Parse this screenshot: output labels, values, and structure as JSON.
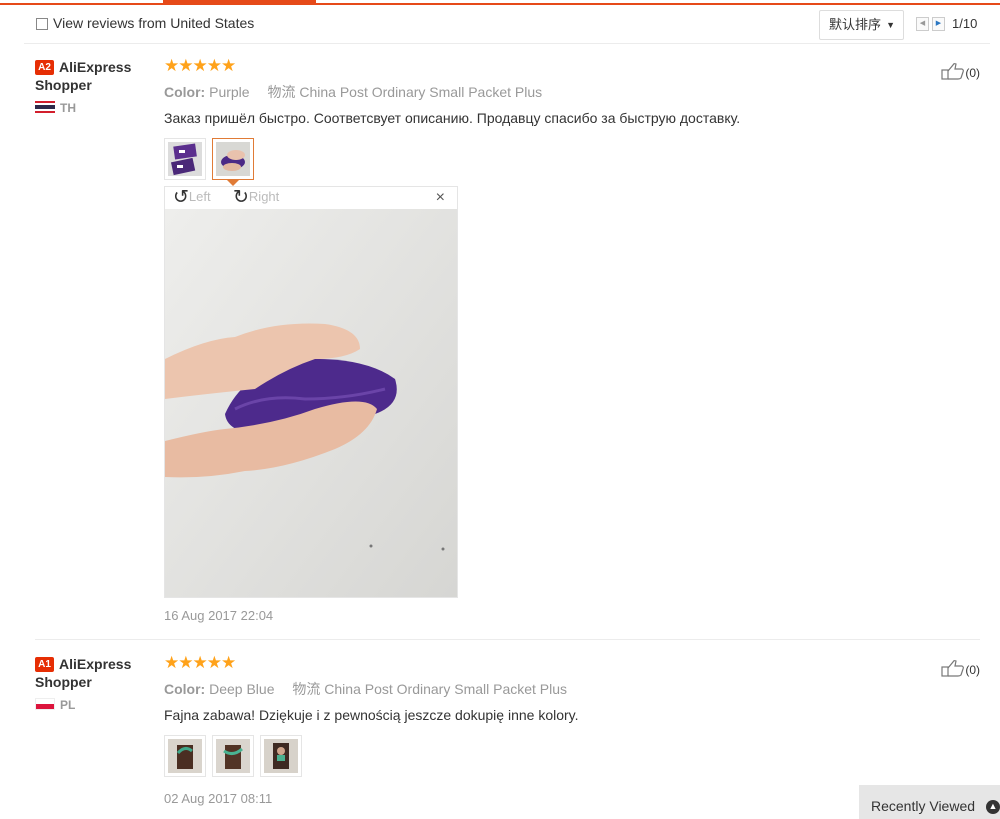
{
  "filter": {
    "checkbox_label": "View reviews from United States",
    "sort_label": "默认排序",
    "page_indicator": "1/10"
  },
  "reviews": [
    {
      "level": "A2",
      "user_first": "AliExpress",
      "user_second": "Shopper",
      "country": "TH",
      "stars": "★★★★★",
      "color_label": "Color:",
      "color_value": "Purple",
      "shipping_label": "物流",
      "shipping_value": "China Post Ordinary Small Packet Plus",
      "text": "Заказ пришёл быстро. Соответсвует описанию. Продавцу спасибо за быструю доставку.",
      "date": "16 Aug 2017 22:04",
      "likes": "(0)"
    },
    {
      "level": "A1",
      "user_first": "AliExpress",
      "user_second": "Shopper",
      "country": "PL",
      "stars": "★★★★★",
      "color_label": "Color:",
      "color_value": "Deep Blue",
      "shipping_label": "物流",
      "shipping_value": "China Post Ordinary Small Packet Plus",
      "text": "Fajna zabawa! Dziękuje i z pewnością jeszcze dokupię inne kolory.",
      "date": "02 Aug 2017 08:11",
      "likes": "(0)"
    }
  ],
  "viewer": {
    "rotate_left": "Left",
    "rotate_right": "Right",
    "close": "×"
  },
  "recently_viewed": "Recently Viewed",
  "colors": {
    "accent": "#e64a19",
    "star": "#ffa21a",
    "level_badge": "#e62e04"
  }
}
